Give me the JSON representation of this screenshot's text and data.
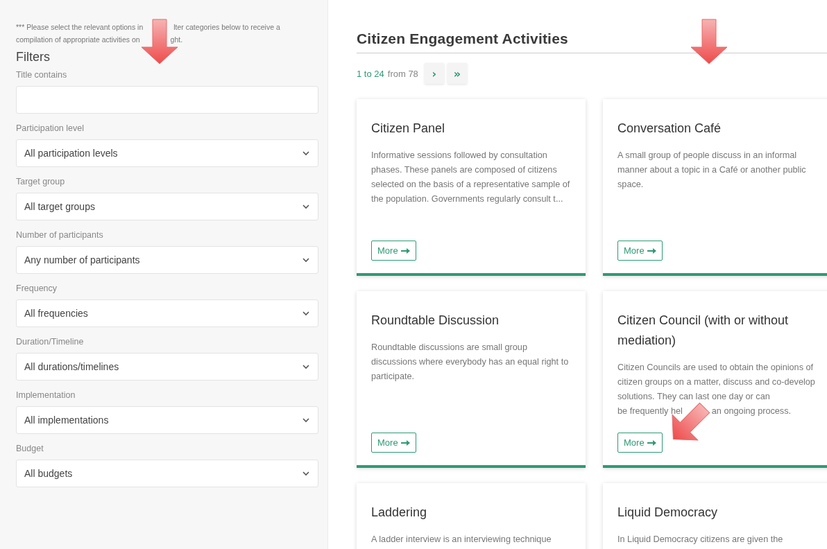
{
  "intro": {
    "pieces": [
      "*** Please select the relevant options in",
      "lter categories below to receive a",
      "compilation of appropriate activities on",
      "ght."
    ]
  },
  "filters": {
    "heading": "Filters",
    "fields": [
      {
        "kind": "text",
        "label": "Title contains"
      },
      {
        "kind": "select",
        "label": "Participation level",
        "value": "All participation levels"
      },
      {
        "kind": "select",
        "label": "Target group",
        "value": "All target groups"
      },
      {
        "kind": "select",
        "label": "Number of participants",
        "value": "Any number of participants"
      },
      {
        "kind": "select",
        "label": "Frequency",
        "value": "All frequencies"
      },
      {
        "kind": "select",
        "label": "Duration/Timeline",
        "value": "All durations/timelines"
      },
      {
        "kind": "select",
        "label": "Implementation",
        "value": "All implementations"
      },
      {
        "kind": "select",
        "label": "Budget",
        "value": "All budgets"
      }
    ]
  },
  "main": {
    "title": "Citizen Engagement Activities",
    "pager": {
      "range": "1 to 24",
      "total": "from 78",
      "next": "›",
      "last": "»"
    },
    "cards": [
      {
        "title": "Citizen Panel",
        "description": [
          "Informative sessions followed by consultation phases. These panels are composed of citizens selected on the basis of a representative sample of the population. Governments regularly consult t..."
        ],
        "button": "More"
      },
      {
        "title": "Conversation Café",
        "description": [
          "A small group of people discuss in an informal manner about a topic in a Café or another public space."
        ],
        "button": "More"
      },
      {
        "title": "Roundtable Discussion",
        "description": [
          "Roundtable discussions are small group discussions where everybody has an equal right to participate."
        ],
        "button": "More"
      },
      {
        "title": "Citizen Council (with or without mediation)",
        "description": [
          "Citizen Councils are used to obtain the opinions of citizen groups on a matter, discuss and co-develop solutions. They can last one day or can",
          "be frequently hel",
          "an ongoing process."
        ],
        "button": "More"
      },
      {
        "title": "Laddering",
        "description": [
          "A ladder interview is an interviewing technique"
        ]
      },
      {
        "title": "Liquid Democracy",
        "description": [
          "In Liquid Democracy citizens are given the"
        ]
      }
    ]
  }
}
